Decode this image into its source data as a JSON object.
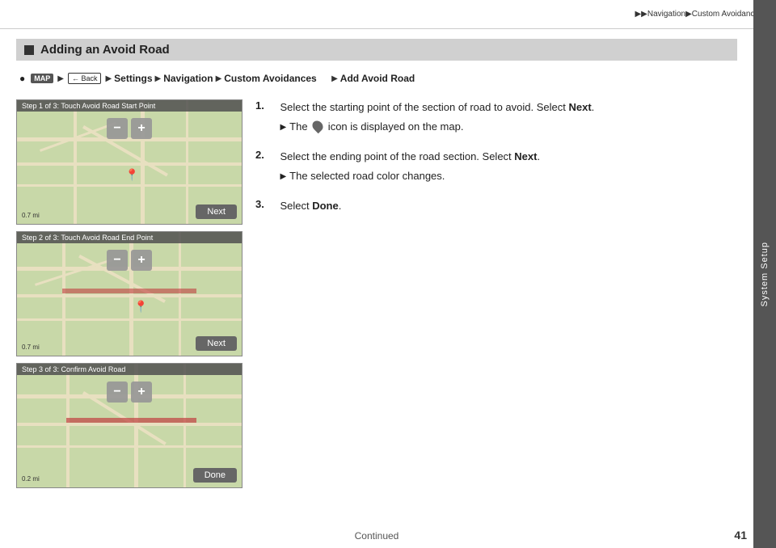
{
  "topbar": {
    "breadcrumb": "▶▶Navigation▶Custom Avoidances"
  },
  "sidebar": {
    "label": "System Setup"
  },
  "section": {
    "title": "Adding an Avoid Road"
  },
  "navpath": {
    "home_icon": "H",
    "map_label": "MAP",
    "back_label": "Back",
    "steps": [
      "Settings",
      "Navigation",
      "Custom Avoidances",
      "Add Avoid Road"
    ]
  },
  "maps": [
    {
      "label": "Step 1 of 3: Touch Avoid Road Start Point",
      "button": "Next",
      "scale": "0.7 mi"
    },
    {
      "label": "Step 2 of 3: Touch Avoid Road End Point",
      "button": "Next",
      "scale": "0.7 mi"
    },
    {
      "label": "Step 3 of 3: Confirm Avoid Road",
      "button": "Done",
      "scale": "0.2 mi"
    }
  ],
  "steps": [
    {
      "number": "1.",
      "text": "Select the starting point of the section of road to avoid. Select ",
      "bold": "Next",
      "text_end": ".",
      "sub_arrow": "▶",
      "sub_text_before": "The ",
      "sub_icon": "avoid",
      "sub_text_after": " icon is displayed on the map."
    },
    {
      "number": "2.",
      "text": "Select the ending point of the road section. Select ",
      "bold": "Next",
      "text_end": ".",
      "sub_arrow": "▶",
      "sub_text": "The selected road color changes."
    },
    {
      "number": "3.",
      "text_before": "Select ",
      "bold": "Done",
      "text_after": "."
    }
  ],
  "footer": {
    "continued": "Continued",
    "page_number": "41"
  }
}
